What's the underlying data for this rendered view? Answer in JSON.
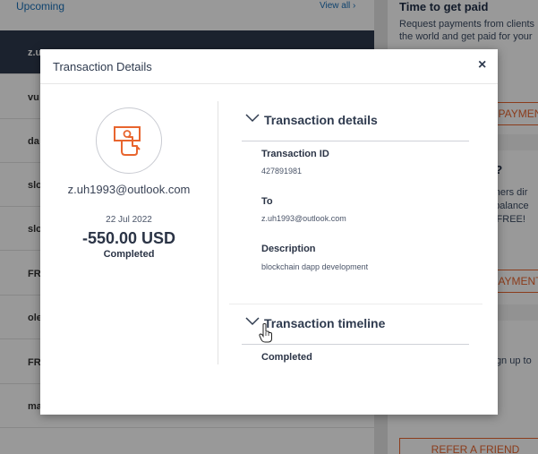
{
  "background": {
    "upcoming_title": "Upcoming",
    "view_all": "View all ›",
    "rows": [
      {
        "text": "z.u",
        "amount": "",
        "active": true
      },
      {
        "text": "vu",
        "amount": ""
      },
      {
        "text": "da",
        "amount": ""
      },
      {
        "text": "slo",
        "amount": ""
      },
      {
        "text": "slo",
        "amount": ""
      },
      {
        "text": "FR",
        "amount": ""
      },
      {
        "text": "ole",
        "amount": ""
      },
      {
        "text": "FR",
        "amount": ""
      },
      {
        "text": "ma",
        "amount": ""
      }
    ],
    "card1": {
      "title": "Time to get paid",
      "line1": "Request payments from clients",
      "line2": "the world and get paid for your",
      "button": "PAYMEN"
    },
    "card2": {
      "title": "y?",
      "line1": "rtners dir",
      "line2": "t balance",
      "line3": "s FREE!",
      "button": "AYMENT"
    },
    "card3": {
      "line1": "sign up to",
      "button": "REFER A FRIEND"
    }
  },
  "modal": {
    "title": "Transaction Details",
    "close_symbol": "×",
    "left": {
      "email": "z.uh1993@outlook.com",
      "date": "22 Jul 2022",
      "amount": "-550.00 USD",
      "status": "Completed"
    },
    "details": {
      "heading": "Transaction details",
      "fields": [
        {
          "label": "Transaction ID",
          "value": "427891981"
        },
        {
          "label": "To",
          "value": "z.uh1993@outlook.com"
        },
        {
          "label": "Description",
          "value": "blockchain dapp development"
        }
      ]
    },
    "timeline": {
      "heading": "Transaction timeline",
      "first_status": "Completed"
    }
  },
  "icons": {
    "avatar": "money-send-icon",
    "collapse": "chevron-down-icon",
    "cursor": "hand-pointer-icon"
  },
  "colors": {
    "accent": "#e8652e",
    "text_dark": "#2f3b4f",
    "active_row": "#2e3a4e"
  }
}
